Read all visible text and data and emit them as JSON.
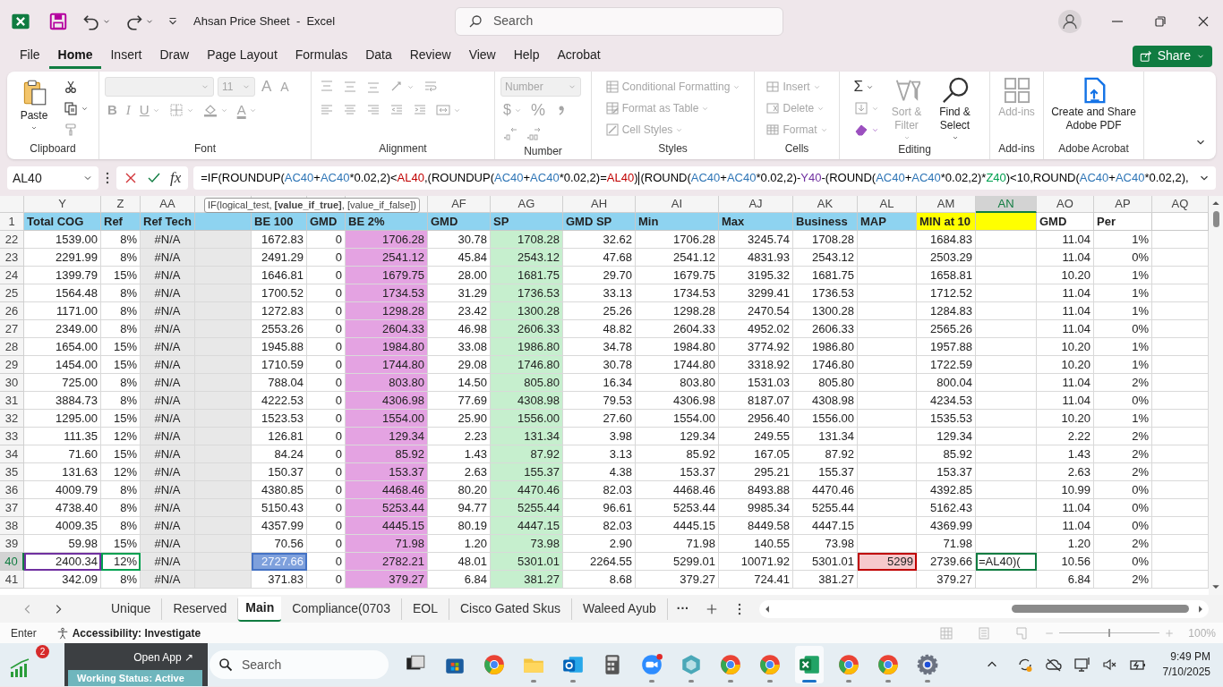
{
  "window": {
    "title": "Ahsan Price Sheet  -  Excel",
    "search_placeholder": "Search"
  },
  "menu_tabs": [
    {
      "label": "File",
      "selected": false
    },
    {
      "label": "Home",
      "selected": true
    },
    {
      "label": "Insert",
      "selected": false
    },
    {
      "label": "Draw",
      "selected": false
    },
    {
      "label": "Page Layout",
      "selected": false
    },
    {
      "label": "Formulas",
      "selected": false
    },
    {
      "label": "Data",
      "selected": false
    },
    {
      "label": "Review",
      "selected": false
    },
    {
      "label": "View",
      "selected": false
    },
    {
      "label": "Help",
      "selected": false
    },
    {
      "label": "Acrobat",
      "selected": false
    }
  ],
  "share_button": "Share",
  "ribbon": {
    "groups": [
      {
        "kind": "clipboard",
        "name": "Clipboard",
        "items": [
          {
            "kind": "paste",
            "label": "Paste",
            "disabled": false
          },
          {
            "kind": "cut",
            "disabled": false
          },
          {
            "kind": "copy",
            "disabled": false
          },
          {
            "kind": "format-painter",
            "disabled": true
          }
        ]
      },
      {
        "kind": "font",
        "name": "Font",
        "items": [
          {
            "kind": "font-name",
            "disabled": true
          },
          {
            "kind": "font-size",
            "label": "11",
            "disabled": true
          },
          {
            "kind": "grow-font",
            "label": "A",
            "disabled": true
          },
          {
            "kind": "shrink-font",
            "label": "A",
            "disabled": true
          },
          {
            "kind": "bold",
            "label": "B",
            "disabled": true
          },
          {
            "kind": "italic",
            "label": "I",
            "disabled": true
          },
          {
            "kind": "underline",
            "label": "U",
            "disabled": true
          },
          {
            "kind": "borders",
            "disabled": true
          },
          {
            "kind": "fill-color",
            "disabled": true
          },
          {
            "kind": "font-color",
            "label": "A",
            "disabled": true
          }
        ]
      },
      {
        "kind": "alignment",
        "name": "Alignment",
        "items": [
          {
            "kind": "top-align",
            "disabled": true
          },
          {
            "kind": "middle-align",
            "disabled": true
          },
          {
            "kind": "bottom-align",
            "disabled": true
          },
          {
            "kind": "orientation",
            "disabled": true
          },
          {
            "kind": "wrap-text",
            "disabled": true
          },
          {
            "kind": "align-left",
            "disabled": true
          },
          {
            "kind": "align-center",
            "disabled": true
          },
          {
            "kind": "align-right",
            "disabled": true
          },
          {
            "kind": "decrease-indent",
            "disabled": true
          },
          {
            "kind": "increase-indent",
            "disabled": true
          },
          {
            "kind": "merge",
            "disabled": true
          }
        ]
      },
      {
        "kind": "number",
        "name": "Number",
        "items": [
          {
            "kind": "number-format",
            "label": "Number",
            "disabled": true
          },
          {
            "kind": "currency",
            "label": "$",
            "disabled": true
          },
          {
            "kind": "percent",
            "label": "%",
            "disabled": true
          },
          {
            "kind": "comma-style",
            "disabled": true
          },
          {
            "kind": "increase-decimal",
            "disabled": true
          },
          {
            "kind": "decrease-decimal",
            "disabled": true
          }
        ]
      },
      {
        "kind": "styles",
        "name": "Styles",
        "items": [
          {
            "kind": "conditional-formatting",
            "label": "Conditional Formatting",
            "disabled": true
          },
          {
            "kind": "format-as-table",
            "label": "Format as Table",
            "disabled": true
          },
          {
            "kind": "cell-styles",
            "label": "Cell Styles",
            "disabled": true
          }
        ]
      },
      {
        "kind": "cells",
        "name": "Cells",
        "items": [
          {
            "kind": "insert",
            "label": "Insert",
            "disabled": true
          },
          {
            "kind": "delete",
            "label": "Delete",
            "disabled": true
          },
          {
            "kind": "format",
            "label": "Format",
            "disabled": true
          }
        ]
      },
      {
        "kind": "editing",
        "name": "Editing",
        "items": [
          {
            "kind": "autosum",
            "label": "Σ",
            "disabled": false
          },
          {
            "kind": "fill",
            "disabled": true
          },
          {
            "kind": "clear",
            "disabled": false
          },
          {
            "kind": "sort-filter",
            "label": "Sort & Filter",
            "disabled": true
          },
          {
            "kind": "find-select",
            "label": "Find & Select",
            "disabled": false
          }
        ]
      },
      {
        "kind": "addins",
        "name": "Add-ins",
        "items": [
          {
            "kind": "add-ins",
            "label": "Add-ins",
            "disabled": true
          }
        ]
      },
      {
        "kind": "acrobat",
        "name": "Adobe Acrobat",
        "items": [
          {
            "kind": "create-pdf",
            "label": "Create and Share Adobe PDF",
            "disabled": false
          }
        ]
      }
    ]
  },
  "formula_bar": {
    "name_box": "AL40",
    "function_button": "fx",
    "segments": [
      {
        "text": "=IF(ROUNDUP("
      },
      {
        "text": "AC40",
        "color": "#2e75b6"
      },
      {
        "text": "+"
      },
      {
        "text": "AC40",
        "color": "#2e75b6"
      },
      {
        "text": "*0.02,2)<"
      },
      {
        "text": "AL40",
        "color": "#c00000"
      },
      {
        "text": ",(ROUNDUP("
      },
      {
        "text": "AC40",
        "color": "#2e75b6"
      },
      {
        "text": "+"
      },
      {
        "text": "AC40",
        "color": "#2e75b6"
      },
      {
        "text": "*0.02,2)="
      },
      {
        "text": "AL40",
        "color": "#c00000"
      },
      {
        "text": ")"
      },
      {
        "kind": "caret"
      },
      {
        "text": "(ROUND("
      },
      {
        "text": "AC40",
        "color": "#2e75b6"
      },
      {
        "text": "+"
      },
      {
        "text": "AC40",
        "color": "#2e75b6"
      },
      {
        "text": "*0.02,2)-"
      },
      {
        "text": "Y40",
        "color": "#7030a0"
      },
      {
        "text": "-(ROUND("
      },
      {
        "text": "AC40",
        "color": "#2e75b6"
      },
      {
        "text": "+"
      },
      {
        "text": "AC40",
        "color": "#2e75b6"
      },
      {
        "text": "*0.02,2)*"
      },
      {
        "text": "Z40",
        "color": "#00a050"
      },
      {
        "text": ")<10,ROUND("
      },
      {
        "text": "AC40",
        "color": "#2e75b6"
      },
      {
        "text": "+"
      },
      {
        "text": "AC40",
        "color": "#2e75b6"
      },
      {
        "text": "*0.02,2),"
      }
    ]
  },
  "tooltip": "IF(logical_test, **[value_if_true]**, [value_if_false])",
  "grid": {
    "columns": [
      {
        "letter": "Y",
        "selected": false
      },
      {
        "letter": "Z",
        "selected": false
      },
      {
        "letter": "AA",
        "selected": false,
        "color": "#e8e8e8"
      },
      {
        "selected": false,
        "color": "#e8e8e8"
      },
      {
        "selected": false
      },
      {
        "selected": false
      },
      {
        "selected": false,
        "color": "#e4a3e2"
      },
      {
        "letter": "AF",
        "selected": false
      },
      {
        "letter": "AG",
        "selected": false,
        "color": "#c6efce"
      },
      {
        "letter": "AH",
        "selected": false
      },
      {
        "letter": "AI",
        "selected": false
      },
      {
        "letter": "AJ",
        "selected": false
      },
      {
        "letter": "AK",
        "selected": false
      },
      {
        "letter": "AL",
        "selected": false
      },
      {
        "letter": "AM",
        "selected": false
      },
      {
        "letter": "AN",
        "selected": true
      },
      {
        "letter": "AO",
        "selected": false
      },
      {
        "letter": "AP",
        "selected": false
      },
      {
        "letter": "AQ",
        "selected": false
      }
    ],
    "header_row": {
      "number": "1",
      "cells": [
        {
          "text": "Total COG",
          "color": "#8ed3f0"
        },
        {
          "text": "Ref",
          "color": "#8ed3f0"
        },
        {
          "text": "Ref Tech",
          "color": "#8ed3f0"
        },
        {
          "color": "#8ed3f0"
        },
        {
          "text": "BE 100",
          "color": "#8ed3f0"
        },
        {
          "text": "GMD",
          "color": "#8ed3f0"
        },
        {
          "text": "BE 2%",
          "color": "#8ed3f0"
        },
        {
          "text": "GMD",
          "color": "#8ed3f0"
        },
        {
          "text": "SP",
          "color": "#8ed3f0"
        },
        {
          "text": "GMD SP",
          "color": "#8ed3f0"
        },
        {
          "text": "Min",
          "color": "#8ed3f0"
        },
        {
          "text": "Max",
          "color": "#8ed3f0"
        },
        {
          "text": "Business",
          "color": "#8ed3f0"
        },
        {
          "text": "MAP",
          "color": "#8ed3f0"
        },
        {
          "text": "MIN at 10",
          "color": "#ffff00"
        },
        {
          "color": "#ffff00"
        },
        {
          "text": "GMD",
          "color": "#ffffff"
        },
        {
          "text": "Per",
          "color": "#ffffff"
        },
        {
          "color": "#ffffff"
        }
      ]
    },
    "rows": [
      {
        "number": "22",
        "selected": false,
        "cells": [
          "1539.00",
          "8%",
          "#N/A",
          null,
          "1672.83",
          "0",
          "1706.28",
          "30.78",
          "1708.28",
          "32.62",
          "1706.28",
          "3245.74",
          "1708.28",
          null,
          "1684.83",
          null,
          "11.04",
          "1%"
        ]
      },
      {
        "number": "23",
        "selected": false,
        "cells": [
          "2291.99",
          "8%",
          "#N/A",
          null,
          "2491.29",
          "0",
          "2541.12",
          "45.84",
          "2543.12",
          "47.68",
          "2541.12",
          "4831.93",
          "2543.12",
          null,
          "2503.29",
          null,
          "11.04",
          "0%"
        ]
      },
      {
        "number": "24",
        "selected": false,
        "cells": [
          "1399.79",
          "15%",
          "#N/A",
          null,
          "1646.81",
          "0",
          "1679.75",
          "28.00",
          "1681.75",
          "29.70",
          "1679.75",
          "3195.32",
          "1681.75",
          null,
          "1658.81",
          null,
          "10.20",
          "1%"
        ]
      },
      {
        "number": "25",
        "selected": false,
        "cells": [
          "1564.48",
          "8%",
          "#N/A",
          null,
          "1700.52",
          "0",
          "1734.53",
          "31.29",
          "1736.53",
          "33.13",
          "1734.53",
          "3299.41",
          "1736.53",
          null,
          "1712.52",
          null,
          "11.04",
          "1%"
        ]
      },
      {
        "number": "26",
        "selected": false,
        "cells": [
          "1171.00",
          "8%",
          "#N/A",
          null,
          "1272.83",
          "0",
          "1298.28",
          "23.42",
          "1300.28",
          "25.26",
          "1298.28",
          "2470.54",
          "1300.28",
          null,
          "1284.83",
          null,
          "11.04",
          "1%"
        ]
      },
      {
        "number": "27",
        "selected": false,
        "cells": [
          "2349.00",
          "8%",
          "#N/A",
          null,
          "2553.26",
          "0",
          "2604.33",
          "46.98",
          "2606.33",
          "48.82",
          "2604.33",
          "4952.02",
          "2606.33",
          null,
          "2565.26",
          null,
          "11.04",
          "0%"
        ]
      },
      {
        "number": "28",
        "selected": false,
        "cells": [
          "1654.00",
          "15%",
          "#N/A",
          null,
          "1945.88",
          "0",
          "1984.80",
          "33.08",
          "1986.80",
          "34.78",
          "1984.80",
          "3774.92",
          "1986.80",
          null,
          "1957.88",
          null,
          "10.20",
          "1%"
        ]
      },
      {
        "number": "29",
        "selected": false,
        "cells": [
          "1454.00",
          "15%",
          "#N/A",
          null,
          "1710.59",
          "0",
          "1744.80",
          "29.08",
          "1746.80",
          "30.78",
          "1744.80",
          "3318.92",
          "1746.80",
          null,
          "1722.59",
          null,
          "10.20",
          "1%"
        ]
      },
      {
        "number": "30",
        "selected": false,
        "cells": [
          "725.00",
          "8%",
          "#N/A",
          null,
          "788.04",
          "0",
          "803.80",
          "14.50",
          "805.80",
          "16.34",
          "803.80",
          "1531.03",
          "805.80",
          null,
          "800.04",
          null,
          "11.04",
          "2%"
        ]
      },
      {
        "number": "31",
        "selected": false,
        "cells": [
          "3884.73",
          "8%",
          "#N/A",
          null,
          "4222.53",
          "0",
          "4306.98",
          "77.69",
          "4308.98",
          "79.53",
          "4306.98",
          "8187.07",
          "4308.98",
          null,
          "4234.53",
          null,
          "11.04",
          "0%"
        ]
      },
      {
        "number": "32",
        "selected": false,
        "cells": [
          "1295.00",
          "15%",
          "#N/A",
          null,
          "1523.53",
          "0",
          "1554.00",
          "25.90",
          "1556.00",
          "27.60",
          "1554.00",
          "2956.40",
          "1556.00",
          null,
          "1535.53",
          null,
          "10.20",
          "1%"
        ]
      },
      {
        "number": "33",
        "selected": false,
        "cells": [
          "111.35",
          "12%",
          "#N/A",
          null,
          "126.81",
          "0",
          "129.34",
          "2.23",
          "131.34",
          "3.98",
          "129.34",
          "249.55",
          "131.34",
          null,
          "129.34",
          null,
          "2.22",
          "2%"
        ]
      },
      {
        "number": "34",
        "selected": false,
        "cells": [
          "71.60",
          "15%",
          "#N/A",
          null,
          "84.24",
          "0",
          "85.92",
          "1.43",
          "87.92",
          "3.13",
          "85.92",
          "167.05",
          "87.92",
          null,
          "85.92",
          null,
          "1.43",
          "2%"
        ]
      },
      {
        "number": "35",
        "selected": false,
        "cells": [
          "131.63",
          "12%",
          "#N/A",
          null,
          "150.37",
          "0",
          "153.37",
          "2.63",
          "155.37",
          "4.38",
          "153.37",
          "295.21",
          "155.37",
          null,
          "153.37",
          null,
          "2.63",
          "2%"
        ]
      },
      {
        "number": "36",
        "selected": false,
        "cells": [
          "4009.79",
          "8%",
          "#N/A",
          null,
          "4380.85",
          "0",
          "4468.46",
          "80.20",
          "4470.46",
          "82.03",
          "4468.46",
          "8493.88",
          "4470.46",
          null,
          "4392.85",
          null,
          "10.99",
          "0%"
        ]
      },
      {
        "number": "37",
        "selected": false,
        "cells": [
          "4738.40",
          "8%",
          "#N/A",
          null,
          "5150.43",
          "0",
          "5253.44",
          "94.77",
          "5255.44",
          "96.61",
          "5253.44",
          "9985.34",
          "5255.44",
          null,
          "5162.43",
          null,
          "11.04",
          "0%"
        ]
      },
      {
        "number": "38",
        "selected": false,
        "cells": [
          "4009.35",
          "8%",
          "#N/A",
          null,
          "4357.99",
          "0",
          "4445.15",
          "80.19",
          "4447.15",
          "82.03",
          "4445.15",
          "8449.58",
          "4447.15",
          null,
          "4369.99",
          null,
          "11.04",
          "0%"
        ]
      },
      {
        "number": "39",
        "selected": false,
        "cells": [
          "59.98",
          "15%",
          "#N/A",
          null,
          "70.56",
          "0",
          "71.98",
          "1.20",
          "73.98",
          "2.90",
          "71.98",
          "140.55",
          "73.98",
          null,
          "71.98",
          null,
          "1.20",
          "2%"
        ]
      },
      {
        "number": "40",
        "selected": true,
        "cells": [
          {
            "text": "2400.34",
            "kind": "reference",
            "color": "#7030a0"
          },
          {
            "text": "12%",
            "kind": "reference",
            "color": "#00a050"
          },
          "#N/A",
          null,
          {
            "text": "2727.66",
            "kind": "reference-active",
            "color": "#4472c4"
          },
          "0",
          "2782.21",
          "48.01",
          "5301.01",
          "2264.55",
          "5299.01",
          "10071.92",
          "5301.01",
          {
            "text": "5299",
            "kind": "reference-flagged",
            "color": "#c00000"
          },
          "2739.66",
          {
            "text": "=AL40)(",
            "kind": "editing"
          },
          "10.56",
          "0%"
        ]
      },
      {
        "number": "41",
        "selected": false,
        "cells": [
          "342.09",
          "8%",
          "#N/A",
          null,
          "371.83",
          "0",
          "379.27",
          "6.84",
          "381.27",
          "8.68",
          "379.27",
          "724.41",
          "381.27",
          null,
          "379.27",
          null,
          "6.84",
          "2%"
        ]
      }
    ]
  },
  "sheet_tabs": [
    {
      "label": "Unique",
      "selected": false
    },
    {
      "label": "Reserved",
      "selected": false
    },
    {
      "label": "Main",
      "selected": true
    },
    {
      "label": "Compliance(0703",
      "selected": false
    },
    {
      "label": "EOL",
      "selected": false
    },
    {
      "label": "Cisco Gated Skus",
      "selected": false
    },
    {
      "label": "Waleed Ayub",
      "selected": false
    }
  ],
  "sheet_more": "···",
  "status_bar": {
    "mode": "Enter",
    "accessibility": "Accessibility: Investigate",
    "zoom": {
      "level": 0.5,
      "reading": "100%"
    }
  },
  "taskbar": {
    "widget_badge": "2",
    "popup": {
      "open_app": "Open App ↗",
      "status": "Working Status: Active"
    },
    "search_placeholder": "Search",
    "apps": [
      {
        "kind": "task-view",
        "selected": false,
        "running": false
      },
      {
        "kind": "store",
        "selected": false,
        "running": false
      },
      {
        "kind": "chrome",
        "selected": false,
        "running": false
      },
      {
        "kind": "folder",
        "selected": false,
        "running": true
      },
      {
        "kind": "outlook",
        "selected": false,
        "running": true
      },
      {
        "kind": "calculator",
        "selected": false,
        "running": false
      },
      {
        "kind": "zoom",
        "selected": false,
        "running": true
      },
      {
        "kind": "hexagon",
        "selected": false,
        "running": true
      },
      {
        "kind": "chrome",
        "selected": false,
        "running": true
      },
      {
        "kind": "chrome",
        "selected": false,
        "running": true
      },
      {
        "kind": "excel",
        "selected": true,
        "running": true
      },
      {
        "kind": "chrome",
        "selected": false,
        "running": true
      },
      {
        "kind": "chrome",
        "selected": false,
        "running": true
      },
      {
        "kind": "settings",
        "selected": false,
        "running": true
      }
    ],
    "time": "9:49 PM",
    "date": "7/10/2025"
  }
}
